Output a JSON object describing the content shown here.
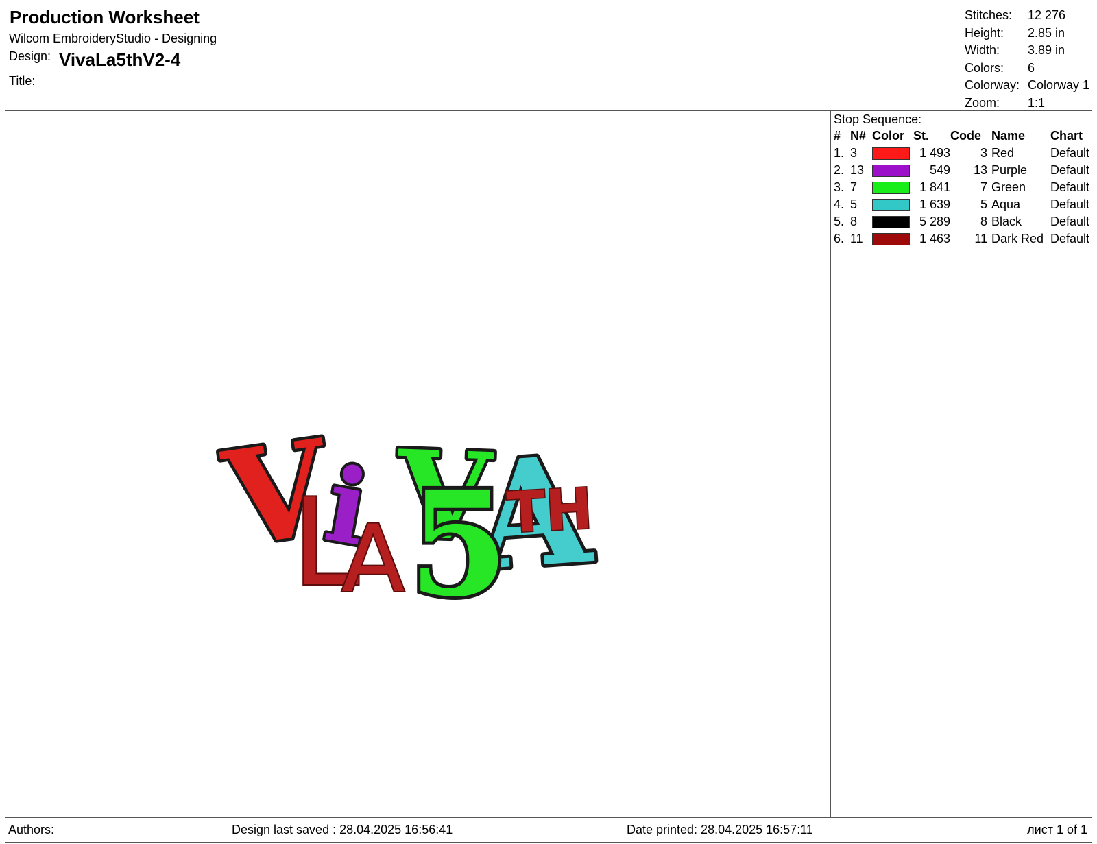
{
  "header": {
    "doc_title": "Production Worksheet",
    "app_name": "Wilcom EmbroideryStudio - Designing",
    "design_label": "Design:",
    "design_value": "VivaLa5thV2-4",
    "title_label": "Title:"
  },
  "stats": [
    {
      "label": "Stitches:",
      "value": "12 276"
    },
    {
      "label": "Height:",
      "value": "2.85 in"
    },
    {
      "label": "Width:",
      "value": "3.89 in"
    },
    {
      "label": "Colors:",
      "value": "6"
    },
    {
      "label": "Colorway:",
      "value": "Colorway 1"
    },
    {
      "label": "Zoom:",
      "value": "1:1"
    }
  ],
  "stop_sequence": {
    "heading": "Stop Sequence:",
    "columns": [
      "#",
      "N#",
      "Color",
      "St.",
      "Code",
      "Name",
      "Chart"
    ],
    "rows": [
      {
        "num": "1.",
        "n": "3",
        "color": "#ff1a1a",
        "st": "1 493",
        "code": "3",
        "name": "Red",
        "chart": "Default"
      },
      {
        "num": "2.",
        "n": "13",
        "color": "#9b10c8",
        "st": "549",
        "code": "13",
        "name": "Purple",
        "chart": "Default"
      },
      {
        "num": "3.",
        "n": "7",
        "color": "#1aee1a",
        "st": "1 841",
        "code": "7",
        "name": "Green",
        "chart": "Default"
      },
      {
        "num": "4.",
        "n": "5",
        "color": "#33c8c8",
        "st": "1 639",
        "code": "5",
        "name": "Aqua",
        "chart": "Default"
      },
      {
        "num": "5.",
        "n": "8",
        "color": "#000000",
        "st": "5 289",
        "code": "8",
        "name": "Black",
        "chart": "Default"
      },
      {
        "num": "6.",
        "n": "11",
        "color": "#9e0a0a",
        "st": "1 463",
        "code": "11",
        "name": "Dark Red",
        "chart": "Default"
      }
    ]
  },
  "design_preview": {
    "line1": [
      "V",
      "i",
      "V",
      "A"
    ],
    "line2": [
      "L",
      "A",
      "5"
    ],
    "superscript": "TH",
    "colors": {
      "red": "#e0211d",
      "purple": "#9b1fc7",
      "green": "#26e626",
      "aqua": "#45cccc",
      "outline": "#1a1a1a",
      "dark_red": "#b51f1f"
    }
  },
  "footer": {
    "authors": "Authors:",
    "saved": "Design last saved : 28.04.2025 16:56:41",
    "printed": "Date printed: 28.04.2025 16:57:11",
    "page": "лист 1 of 1"
  }
}
